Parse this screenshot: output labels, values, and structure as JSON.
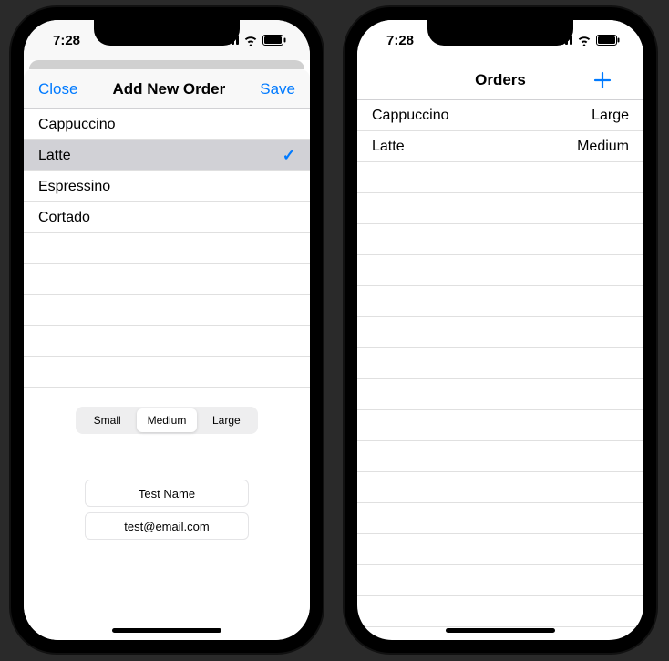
{
  "accent": "#007aff",
  "statusbar": {
    "time": "7:28"
  },
  "left": {
    "close": "Close",
    "title": "Add New Order",
    "save": "Save",
    "drinks": [
      {
        "name": "Cappuccino",
        "selected": false
      },
      {
        "name": "Latte",
        "selected": true
      },
      {
        "name": "Espressino",
        "selected": false
      },
      {
        "name": "Cortado",
        "selected": false
      }
    ],
    "sizes": {
      "options": [
        "Small",
        "Medium",
        "Large"
      ],
      "selected": "Medium"
    },
    "fields": {
      "name": "Test Name",
      "email": "test@email.com"
    }
  },
  "right": {
    "title": "Orders",
    "add_icon": "plus",
    "orders": [
      {
        "name": "Cappuccino",
        "size": "Large"
      },
      {
        "name": "Latte",
        "size": "Medium"
      }
    ]
  }
}
